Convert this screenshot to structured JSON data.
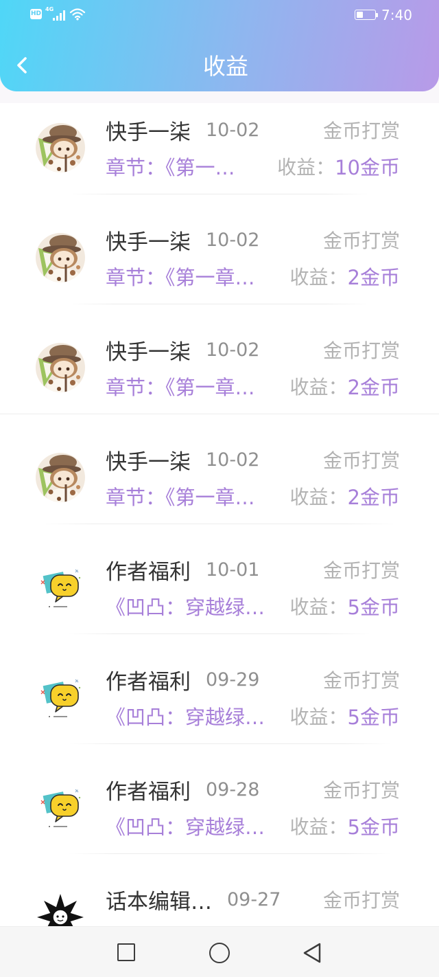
{
  "status_bar": {
    "hd_label": "HD",
    "network_label": "4G",
    "signal_icon": "signal-bars-icon",
    "wifi_icon": "wifi-icon",
    "battery_icon": "battery-icon",
    "battery_level": 0.35,
    "time": "7:40"
  },
  "header": {
    "back_icon": "chevron-left-icon",
    "title": "收益"
  },
  "colors": {
    "header_gradient_start": "#4fd7f7",
    "header_gradient_end": "#b89ae8",
    "accent_purple": "#a77fd9",
    "muted_text": "#b3b3b3"
  },
  "records": [
    {
      "avatar": "girl-with-hat",
      "name": "快手一柒",
      "date": "10-02",
      "type": "金币打赏",
      "detail": "章节：《第一…",
      "income_label": "收益：",
      "income": "10金币"
    },
    {
      "avatar": "girl-with-hat",
      "name": "快手一柒",
      "date": "10-02",
      "type": "金币打赏",
      "detail": "章节：《第一章…",
      "income_label": "收益：",
      "income": "2金币"
    },
    {
      "avatar": "girl-with-hat",
      "name": "快手一柒",
      "date": "10-02",
      "type": "金币打赏",
      "detail": "章节：《第一章…",
      "income_label": "收益：",
      "income": "2金币"
    },
    {
      "avatar": "girl-with-hat",
      "name": "快手一柒",
      "date": "10-02",
      "type": "金币打赏",
      "detail": "章节：《第一章…",
      "income_label": "收益：",
      "income": "2金币"
    },
    {
      "avatar": "yellow-chat-bubble",
      "name": "作者福利",
      "date": "10-01",
      "type": "金币打赏",
      "detail": "《凹凸：穿越绿…",
      "income_label": "收益：",
      "income": "5金币"
    },
    {
      "avatar": "yellow-chat-bubble",
      "name": "作者福利",
      "date": "09-29",
      "type": "金币打赏",
      "detail": "《凹凸：穿越绿…",
      "income_label": "收益：",
      "income": "5金币"
    },
    {
      "avatar": "yellow-chat-bubble",
      "name": "作者福利",
      "date": "09-28",
      "type": "金币打赏",
      "detail": "《凹凸：穿越绿…",
      "income_label": "收益：",
      "income": "5金币"
    },
    {
      "avatar": "spiky-black-silhouette",
      "name": "话本编辑…",
      "date": "09-27",
      "type": "金币打赏"
    }
  ],
  "nav_bar": {
    "recent_apps_icon": "square-icon",
    "home_icon": "circle-icon",
    "back_icon": "triangle-back-icon"
  }
}
